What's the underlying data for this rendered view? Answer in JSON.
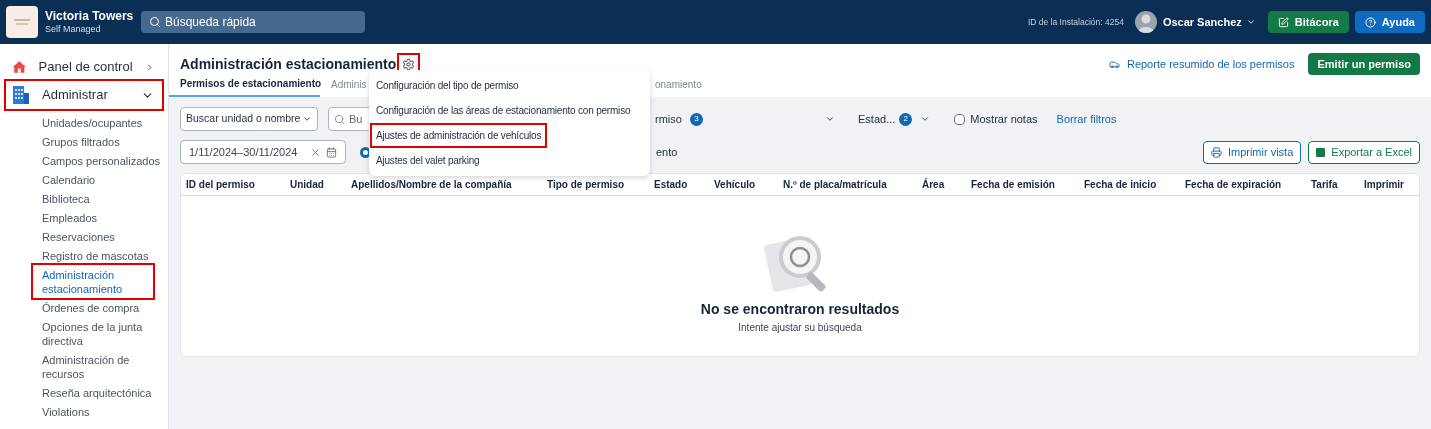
{
  "topbar": {
    "org_name": "Victoria Towers",
    "org_subtitle": "Self Managed",
    "search": {
      "placeholder": "Búsqueda rápida"
    },
    "install_id": "ID de la Instalación: 4254",
    "user_name": "Oscar Sanchez",
    "buttons": [
      {
        "label": "Bitácora",
        "kind": "log"
      },
      {
        "label": "Ayuda",
        "kind": "help"
      }
    ]
  },
  "sidebar": {
    "items": [
      {
        "label": "Panel de control",
        "kind": "home",
        "expanded": false,
        "highlighted": false
      },
      {
        "label": "Administrar",
        "kind": "building",
        "expanded": true,
        "highlighted": true,
        "children": [
          {
            "label": "Unidades/ocupantes",
            "selected": false,
            "highlighted": false
          },
          {
            "label": "Grupos filtrados",
            "selected": false,
            "highlighted": false
          },
          {
            "label": "Campos personalizados",
            "selected": false,
            "highlighted": false
          },
          {
            "label": "Calendario",
            "selected": false,
            "highlighted": false
          },
          {
            "label": "Biblioteca",
            "selected": false,
            "highlighted": false
          },
          {
            "label": "Empleados",
            "selected": false,
            "highlighted": false
          },
          {
            "label": "Reservaciones",
            "selected": false,
            "highlighted": false
          },
          {
            "label": "Registro de mascotas",
            "selected": false,
            "highlighted": false
          },
          {
            "label": "Administración estacionamiento",
            "selected": true,
            "highlighted": true
          },
          {
            "label": "Órdenes de compra",
            "selected": false,
            "highlighted": false
          },
          {
            "label": "Opciones de la junta directiva",
            "selected": false,
            "highlighted": false
          },
          {
            "label": "Administración de recursos",
            "selected": false,
            "highlighted": false
          },
          {
            "label": "Reseña arquitectónica",
            "selected": false,
            "highlighted": false
          },
          {
            "label": "Violations",
            "selected": false,
            "highlighted": false
          }
        ]
      }
    ]
  },
  "page": {
    "title": "Administración estacionamiento",
    "settings_highlighted": true,
    "report_link": "Reporte resumido de los permisos",
    "primary_button": "Emitir un permiso",
    "tabs": [
      {
        "label": "Permisos de estacionamiento",
        "selected": true
      },
      {
        "label": "Adminis",
        "selected": false
      },
      {
        "label": "onamiento",
        "selected": false
      }
    ],
    "settings_menu": [
      {
        "label": "Configuración del tipo de permiso",
        "highlighted": false
      },
      {
        "label": "Configuración de las áreas de estacionamiento con permiso",
        "highlighted": false
      },
      {
        "label": "Ajustes de administración de vehículos",
        "highlighted": true
      },
      {
        "label": "Ajustes del valet parking",
        "highlighted": false
      }
    ],
    "filters": {
      "unit_select": "Buscar unidad o nombre",
      "search": {
        "placeholder": "Bu"
      },
      "permit_type": {
        "label": "rmiso",
        "count": "3"
      },
      "status": {
        "label": "Estad...",
        "count": "2"
      },
      "show_notes": {
        "label": "Mostrar notas",
        "checked": false
      },
      "clear": "Borrar filtros",
      "date_range": "1/11/2024–30/11/2024",
      "radio": {
        "label": "ento",
        "selected": true
      }
    },
    "actions": [
      "Imprimir vista",
      "Exportar a Excel"
    ],
    "table": {
      "columns": [
        "ID del permiso",
        "Unidad",
        "Apellidos/Nombre de la compañía",
        "Tipo de permiso",
        "Estado",
        "Vehículo",
        "N.º de placa/matrícula",
        "Área",
        "Fecha de emisión",
        "Fecha de inicio",
        "Fecha de expiración",
        "Tarifa",
        "Imprimir"
      ],
      "empty_title": "No se encontraron resultados",
      "empty_hint": "Intente ajustar su búsqueda"
    }
  }
}
